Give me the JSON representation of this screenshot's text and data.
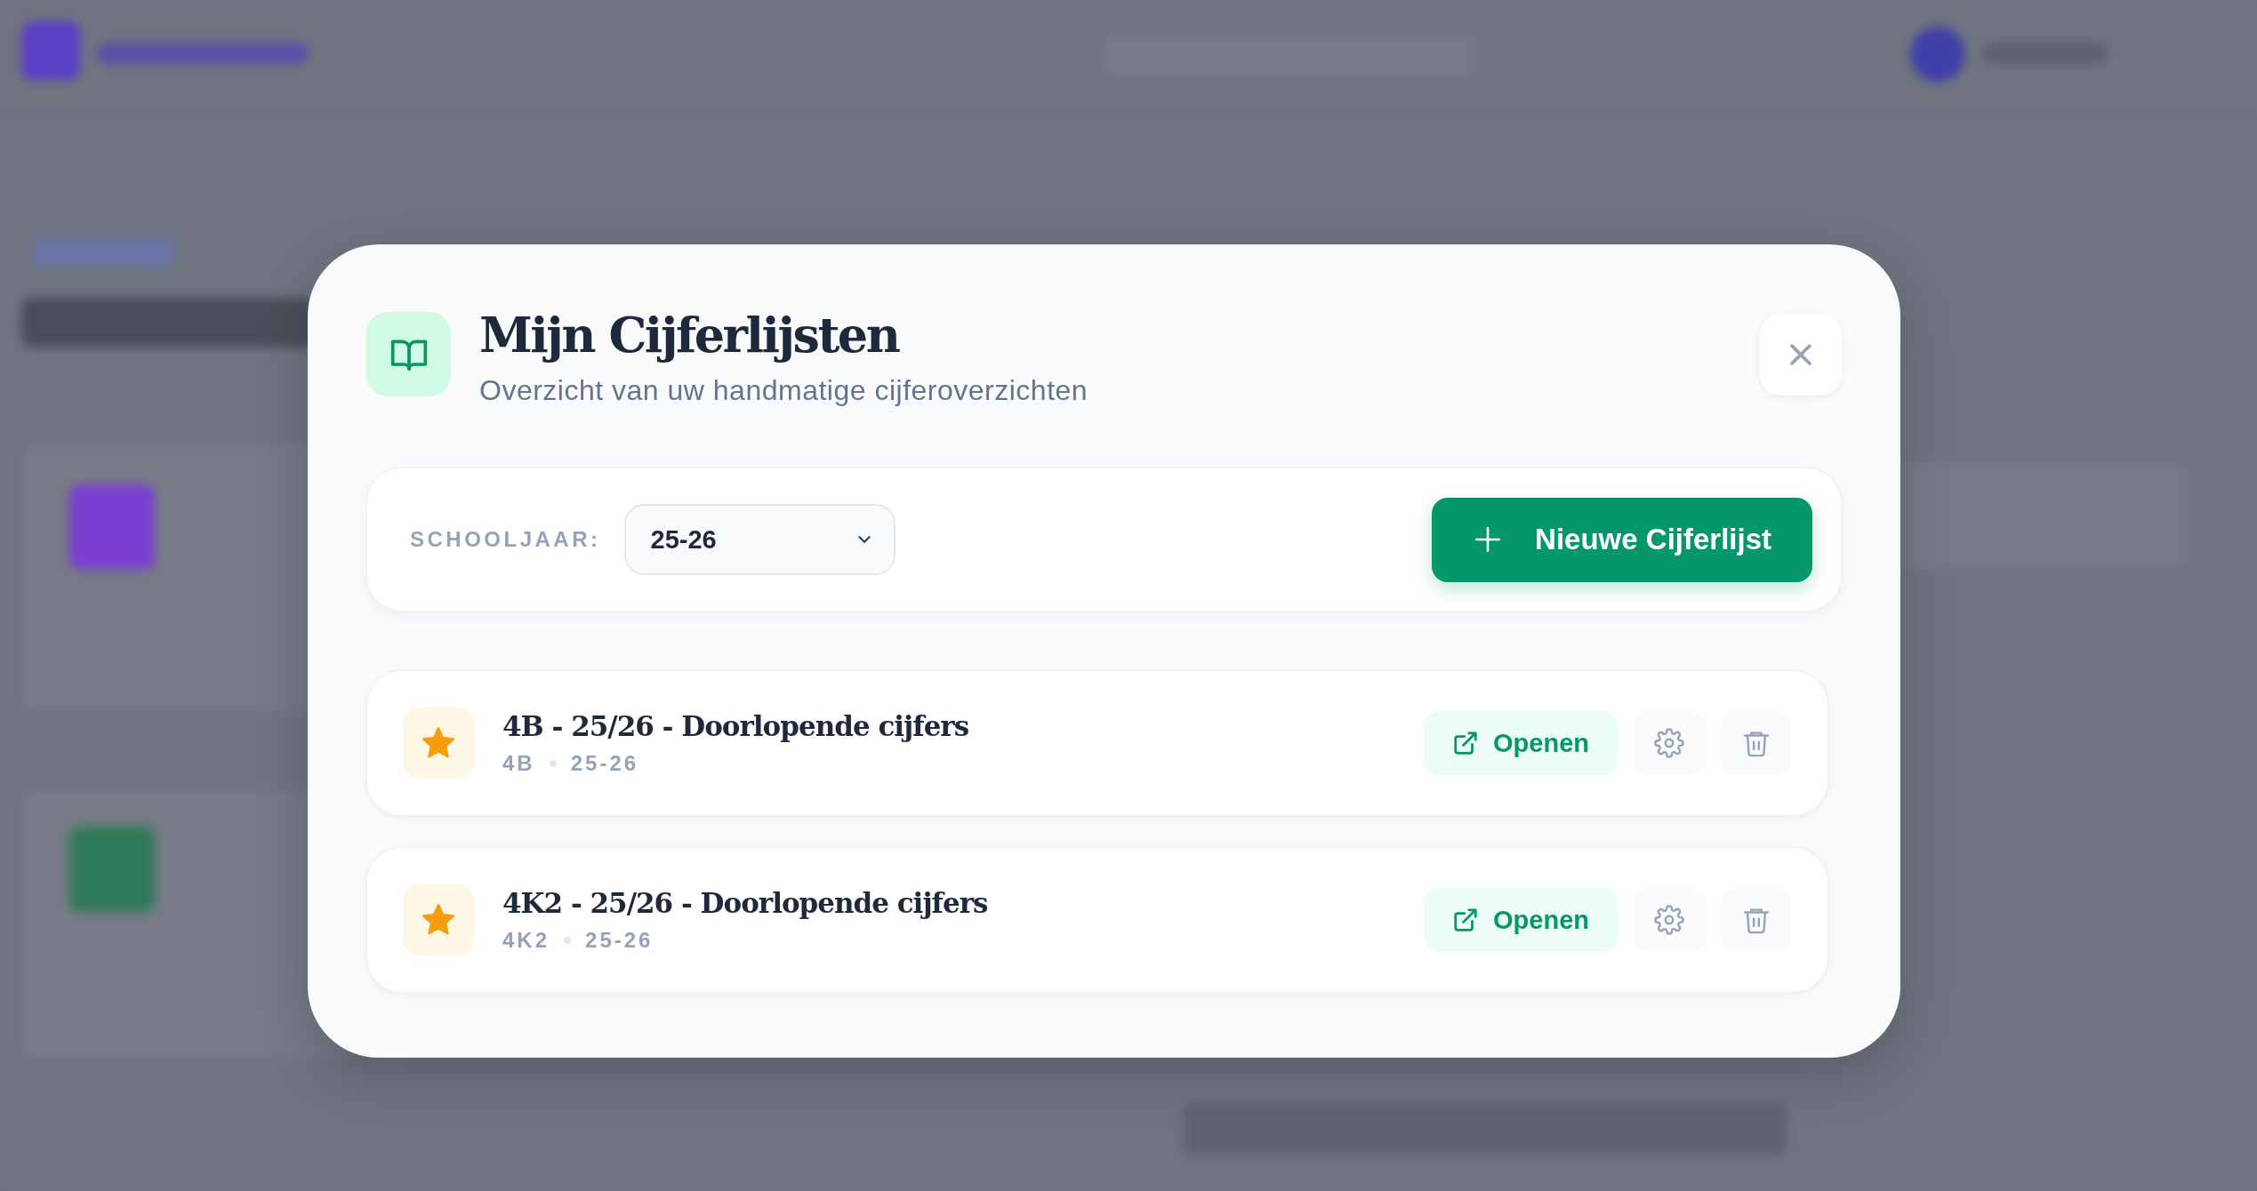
{
  "dialog": {
    "title": "Mijn Cijferlijsten",
    "subtitle": "Overzicht van uw handmatige cijferoverzichten"
  },
  "filter": {
    "label": "SCHOOLJAAR:",
    "value": "25-26"
  },
  "new_button": {
    "label": "Nieuwe Cijferlijst"
  },
  "lists": [
    {
      "title": "4B - 25/26 - Doorlopende cijfers",
      "class": "4B",
      "year": "25-26",
      "favorite": true,
      "open_label": "Openen"
    },
    {
      "title": "4K2 - 25/26 - Doorlopende cijfers",
      "class": "4K2",
      "year": "25-26",
      "favorite": true,
      "open_label": "Openen"
    }
  ]
}
